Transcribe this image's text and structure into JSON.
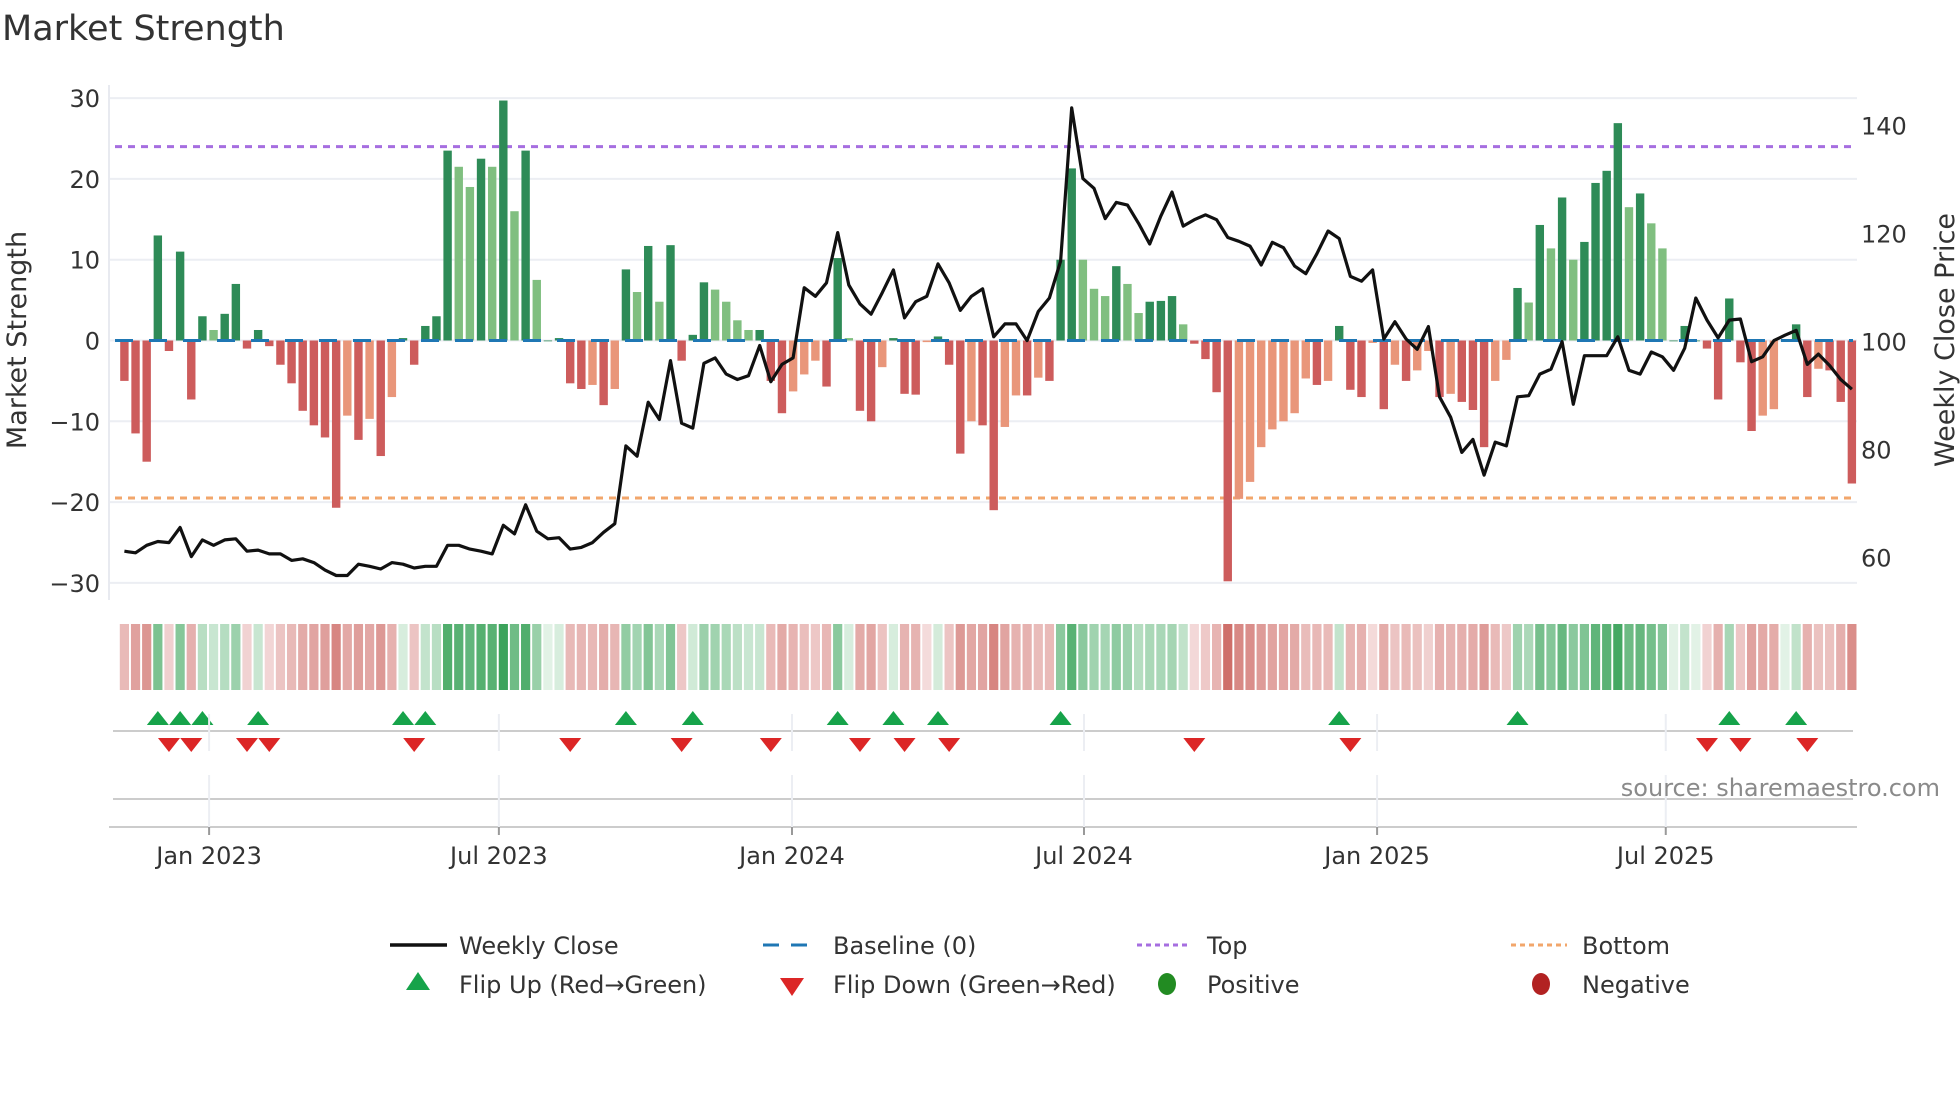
{
  "chart_data": {
    "type": "bar",
    "title": "Market Strength",
    "ylabel": "Market Strength",
    "y2label": "Weekly Close Price",
    "ylim": [
      -32,
      32
    ],
    "y2lim": [
      52.5,
      147.5
    ],
    "yticks": [
      "30",
      "20",
      "10",
      "0",
      "−10",
      "−20",
      "−30"
    ],
    "yticks_values": [
      30,
      20,
      10,
      0,
      -10,
      -20,
      -30
    ],
    "y2ticks": [
      "140",
      "120",
      "100",
      "80",
      "60"
    ],
    "y2ticks_values": [
      140,
      120,
      100,
      80,
      60
    ],
    "xticks": [
      "Jan 2023",
      "Jul 2023",
      "Jan 2024",
      "Jul 2024",
      "Jan 2025",
      "Jul 2025"
    ],
    "xticks_week_index": [
      7.6,
      33.6,
      59.9,
      86.1,
      112.4,
      138.3
    ],
    "grid": true,
    "legend_position": "bottom",
    "top_level": 24,
    "bottom_level": -19.5,
    "baseline": 0,
    "strength": [
      -5,
      -11.5,
      -15,
      13,
      -1.3,
      11,
      -7.3,
      3,
      1.3,
      3.3,
      7,
      -1,
      1.3,
      -0.7,
      -3,
      -5.3,
      -8.7,
      -10.5,
      -12,
      -20.7,
      -9.3,
      -12.3,
      -9.7,
      -14.3,
      -7,
      0.3,
      -3,
      1.8,
      3,
      23.5,
      21.5,
      19,
      22.5,
      21.5,
      29.7,
      16,
      23.5,
      7.5,
      0,
      0.3,
      -5.3,
      -6,
      -5.5,
      -8,
      -6,
      8.8,
      6,
      11.7,
      4.8,
      11.8,
      -2.5,
      0.7,
      7.2,
      6.3,
      4.8,
      2.5,
      1.3,
      1.3,
      -5,
      -9,
      -6.3,
      -4.2,
      -2.5,
      -5.7,
      10.2,
      0.3,
      -8.7,
      -10,
      -3.3,
      0.3,
      -6.6,
      -6.7,
      -0.2,
      0.5,
      -3,
      -14,
      -10,
      -10.5,
      -21,
      -10.7,
      -6.8,
      -6.8,
      -4.6,
      -5,
      10,
      21.3,
      10,
      6.4,
      5.5,
      9.2,
      7,
      3.4,
      4.8,
      4.9,
      5.5,
      2,
      -0.4,
      -2.3,
      -6.4,
      -29.8,
      -19.6,
      -17.5,
      -13.2,
      -11,
      -10,
      -9,
      -4.7,
      -5.5,
      -5,
      1.8,
      -6.1,
      -7,
      -0.3,
      -8.5,
      -3,
      -5,
      -3.7,
      -1.3,
      -7,
      -6.6,
      -7.6,
      -8.6,
      -13.2,
      -5,
      -2.4,
      6.5,
      4.7,
      14.3,
      11.4,
      17.7,
      10,
      12.2,
      19.5,
      21,
      26.9,
      16.5,
      18.2,
      14.5,
      11.4,
      0,
      1.8,
      0,
      -1,
      -7.3,
      5.2,
      -2.7,
      -11.2,
      -9.3,
      -8.5,
      0,
      2,
      -7,
      -3.5,
      -3.7,
      -7.6,
      -17.7
    ],
    "weekly_close": [
      61.2,
      60.9,
      62.3,
      63.0,
      62.8,
      65.6,
      60.2,
      63.3,
      62.3,
      63.3,
      63.5,
      61.2,
      61.4,
      60.7,
      60.7,
      59.5,
      59.8,
      59.1,
      57.7,
      56.7,
      56.7,
      58.8,
      58.4,
      57.9,
      59.1,
      58.8,
      58.1,
      58.4,
      58.4,
      62.3,
      62.3,
      61.6,
      61.2,
      60.7,
      66.0,
      64.4,
      69.8,
      64.9,
      63.5,
      63.7,
      61.6,
      61.9,
      62.8,
      64.7,
      66.3,
      80.7,
      78.8,
      88.8,
      85.6,
      96.5,
      84.9,
      84.0,
      96.0,
      97.0,
      94.0,
      93.0,
      93.7,
      99.3,
      92.6,
      95.8,
      97.0,
      110.0,
      108.4,
      110.9,
      120.2,
      110.5,
      107.0,
      105.1,
      109.1,
      113.3,
      104.4,
      107.4,
      108.4,
      114.4,
      110.9,
      105.8,
      108.4,
      109.8,
      100.9,
      103.3,
      103.3,
      100.2,
      105.6,
      108.1,
      114.9,
      143.3,
      130.2,
      128.4,
      122.8,
      125.8,
      125.3,
      121.9,
      118.1,
      123.3,
      127.7,
      121.4,
      122.6,
      123.5,
      122.6,
      119.3,
      118.6,
      117.7,
      114.2,
      118.4,
      117.4,
      114.0,
      112.6,
      116.3,
      120.5,
      119.1,
      112.1,
      111.2,
      113.3,
      100.5,
      103.7,
      100.5,
      98.6,
      102.8,
      89.8,
      86.0,
      79.5,
      81.9,
      75.3,
      81.4,
      80.7,
      89.8,
      90.0,
      94.0,
      94.9,
      100.0,
      88.4,
      97.4,
      97.4,
      97.4,
      100.9,
      94.7,
      94.0,
      98.1,
      97.2,
      94.7,
      98.8,
      108.1,
      104.0,
      100.7,
      104.0,
      104.2,
      96.3,
      97.2,
      100.2,
      101.2,
      102.1,
      95.8,
      97.7,
      95.6,
      93.0,
      91.2
    ],
    "flip_up_week_index": [
      3,
      5,
      7,
      12,
      25,
      27,
      45,
      51,
      64,
      69,
      73,
      84,
      109,
      125,
      144,
      150
    ],
    "flip_down_week_index": [
      4,
      6,
      11,
      13,
      26,
      40,
      50,
      58,
      66,
      70,
      74,
      96,
      110,
      142,
      145,
      151
    ],
    "colors": {
      "positive_rising": "#2e8b57",
      "positive_falling": "#80bf80",
      "negative_rising": "#cd5c5c",
      "negative_falling": "#e9967a",
      "baseline": "#1f77b4",
      "top": "#a66ee0",
      "bottom": "#f2a66b",
      "flip_up": "#16a34a",
      "flip_down": "#dc2626",
      "positive": "#228b22",
      "negative": "#b22222"
    }
  },
  "legend": {
    "weekly_close": "Weekly Close",
    "baseline": "Baseline (0)",
    "top": "Top",
    "bottom": "Bottom",
    "flip_up": "Flip Up (Red→Green)",
    "flip_down": "Flip Down (Green→Red)",
    "positive": "Positive",
    "negative": "Negative"
  },
  "source": "source: sharemaestro.com"
}
